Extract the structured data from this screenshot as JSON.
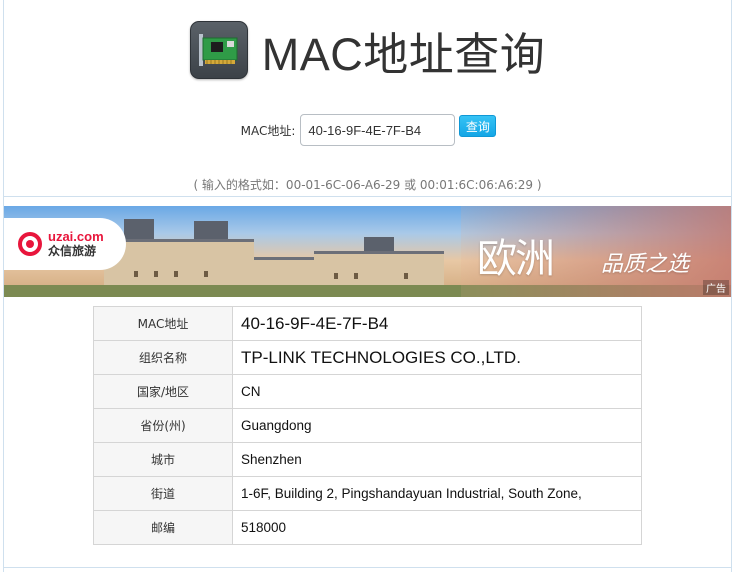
{
  "header": {
    "title": "MAC地址查询",
    "logo_icon": "network-card-icon"
  },
  "search": {
    "label": "MAC地址:",
    "value": "40-16-9F-4E-7F-B4",
    "button_label": "查询"
  },
  "hint": "( 输入的格式如：00-01-6C-06-A6-29 或 00:01:6C:06:A6:29 )",
  "banner": {
    "brand_domain": "uzai.com",
    "brand_name": "众信旅游",
    "headline": "欧洲",
    "tagline": "品质之选",
    "ad_label": "广告"
  },
  "result": {
    "rows": [
      {
        "key": "MAC地址",
        "value": "40-16-9F-4E-7F-B4"
      },
      {
        "key": "组织名称",
        "value": "TP-LINK TECHNOLOGIES CO.,LTD."
      },
      {
        "key": "国家/地区",
        "value": "CN"
      },
      {
        "key": "省份(州)",
        "value": "Guangdong"
      },
      {
        "key": "城市",
        "value": "Shenzhen"
      },
      {
        "key": "街道",
        "value": "1-6F, Building 2, Pingshandayuan Industrial, South Zone,"
      },
      {
        "key": "邮编",
        "value": "518000"
      }
    ]
  },
  "colors": {
    "accent": "#14a6e6",
    "brand_red": "#e8163c",
    "border": "#cfe0ee"
  }
}
